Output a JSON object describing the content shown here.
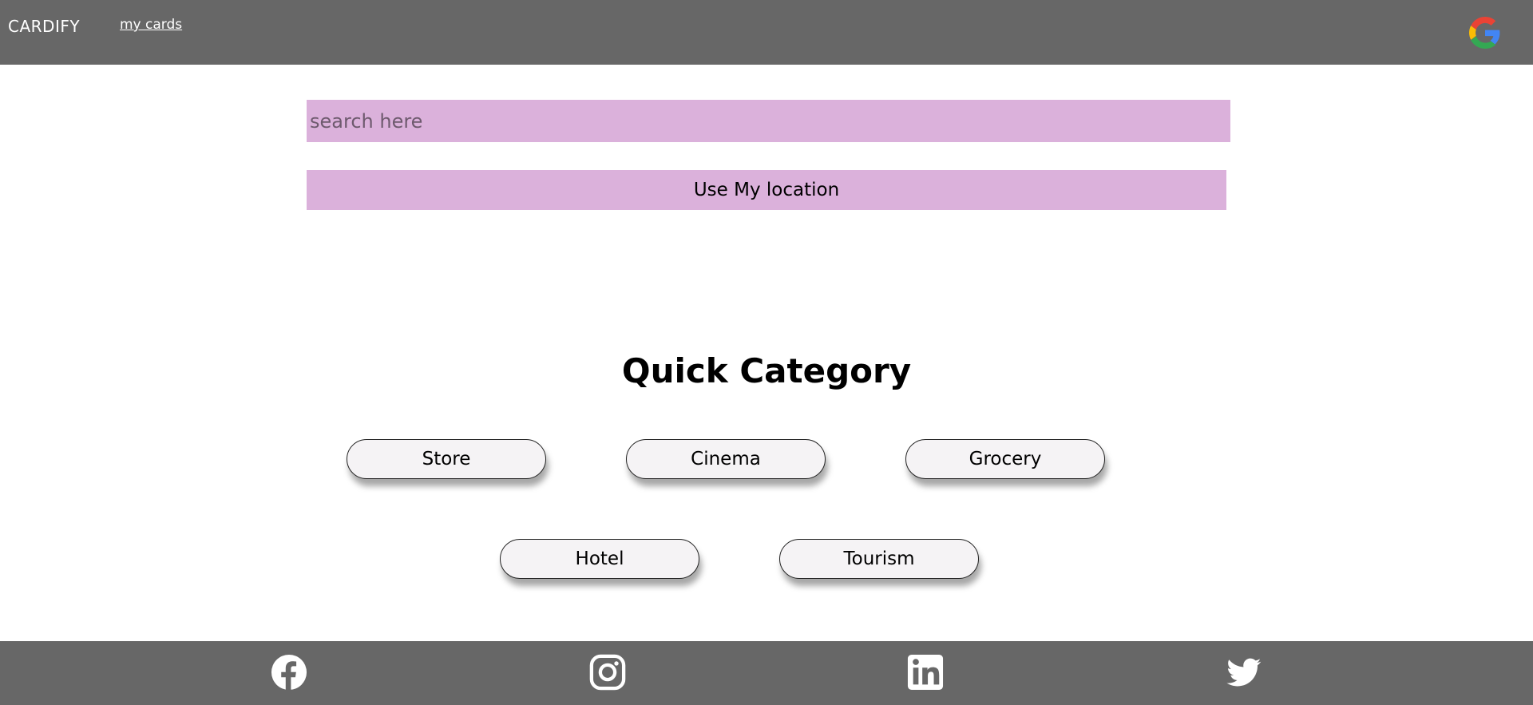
{
  "header": {
    "brand": "CARDIFY",
    "nav_link": "my cards",
    "google_icon": "google-icon",
    "background": "#676767"
  },
  "search": {
    "placeholder": "search here",
    "value": "",
    "background": "#dbb1db"
  },
  "location_button": {
    "label": "Use My location"
  },
  "quick_category": {
    "title": "Quick Category",
    "items": [
      "Store",
      "Cinema",
      "Grocery",
      "Hotel",
      "Tourism"
    ]
  },
  "footer": {
    "icons": [
      "facebook-icon",
      "instagram-icon",
      "linkedin-icon",
      "twitter-icon"
    ],
    "background": "#676767"
  }
}
